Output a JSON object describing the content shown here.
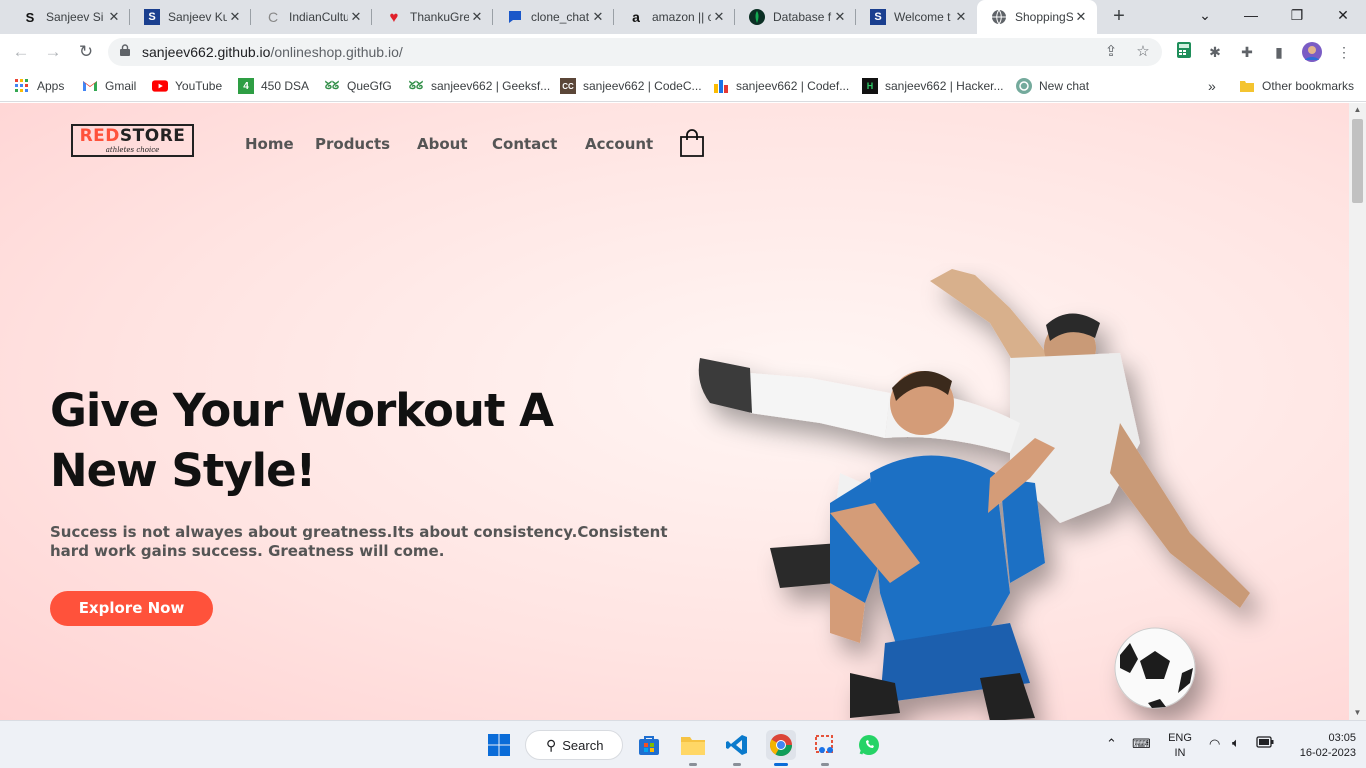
{
  "browser": {
    "tabs": [
      {
        "title": "Sanjeev Si",
        "favicon": "S"
      },
      {
        "title": "Sanjeev Ku",
        "favicon": "S"
      },
      {
        "title": "IndianCultu",
        "favicon": "C"
      },
      {
        "title": "ThankuGre",
        "favicon": "heart"
      },
      {
        "title": "clone_chat",
        "favicon": "chat"
      },
      {
        "title": "amazon || c",
        "favicon": "a"
      },
      {
        "title": "Database f",
        "favicon": "leaf"
      },
      {
        "title": "Welcome t",
        "favicon": "S"
      },
      {
        "title": "ShoppingS",
        "favicon": "globe",
        "active": true
      }
    ],
    "new_tab": "+",
    "address": {
      "host": "sanjeev662.github.io",
      "path": "/onlineshop.github.io/"
    },
    "bookmarks": [
      {
        "label": "Apps",
        "icon": "apps-grid-icon"
      },
      {
        "label": "Gmail",
        "icon": "gmail-icon"
      },
      {
        "label": "YouTube",
        "icon": "youtube-icon"
      },
      {
        "label": "450 DSA",
        "icon": "4"
      },
      {
        "label": "QueGfG",
        "icon": "gfg-icon"
      },
      {
        "label": "sanjeev662 | Geeksf...",
        "icon": "gfg-icon"
      },
      {
        "label": "sanjeev662 | CodeC...",
        "icon": "codechef-icon"
      },
      {
        "label": "sanjeev662 | Codef...",
        "icon": "codeforces-icon"
      },
      {
        "label": "sanjeev662 | Hacker...",
        "icon": "hackerrank-icon"
      },
      {
        "label": "New chat",
        "icon": "openai-icon"
      }
    ],
    "more_bookmarks": "»",
    "other_bookmarks": "Other bookmarks"
  },
  "site": {
    "logo": {
      "brand_red": "RED",
      "brand_rest": "STORE",
      "tagline": "athletes choice"
    },
    "nav": [
      "Home",
      "Products",
      "About",
      "Contact",
      "Account"
    ],
    "headline_line1": "Give Your Workout A",
    "headline_line2": "New Style!",
    "subtext": "Success is not alwayes about greatness.Its about consistency.Consistent hard work gains success. Greatness will come.",
    "cta": "Explore Now",
    "accent": "#ff523b"
  },
  "taskbar": {
    "search": "Search",
    "lang_top": "ENG",
    "lang_bottom": "IN",
    "time": "03:05",
    "date": "16-02-2023"
  }
}
